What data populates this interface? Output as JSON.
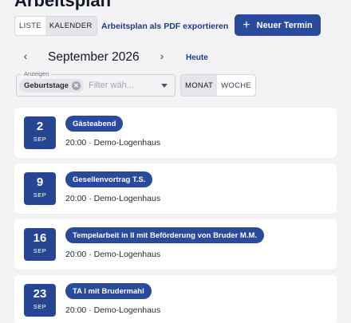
{
  "page": {
    "title": "Arbeitsplan"
  },
  "toolbar": {
    "view_options": [
      {
        "label": "LISTE",
        "active": false
      },
      {
        "label": "KALENDER",
        "active": true
      }
    ],
    "pdf_export_label": "Arbeitsplan als PDF exportieren",
    "new_event_label": "Neuer Termin",
    "new_event_icon": "plus-icon",
    "accent_color": "#2a4a9b"
  },
  "navigation": {
    "prev_icon": "chevron-left-icon",
    "next_icon": "chevron-right-icon",
    "month_label": "September 2026",
    "today_label": "Heute"
  },
  "filter": {
    "legend": "Anzeigen",
    "chips": [
      {
        "label": "Geburtstage"
      }
    ],
    "placeholder": "Filter wäh...",
    "caret_icon": "caret-down-icon"
  },
  "range_options": [
    {
      "label": "MONAT",
      "active": true
    },
    {
      "label": "WOCHE",
      "active": false
    }
  ],
  "events": [
    {
      "day": "2",
      "month": "SEP",
      "title": "Gästeabend",
      "meta": "20:00 · Demo-Logenhaus"
    },
    {
      "day": "9",
      "month": "SEP",
      "title": "Gesellenvortrag T.S.",
      "meta": "20:00 · Demo-Logenhaus"
    },
    {
      "day": "16",
      "month": "SEP",
      "title": "Tempelarbeit in II mit Beförderung von Bruder M.M.",
      "meta": "20:00 · Demo-Logenhaus"
    },
    {
      "day": "23",
      "month": "SEP",
      "title": "TA I mit Brudermahl",
      "meta": "20:00 · Demo-Logenhaus"
    }
  ]
}
